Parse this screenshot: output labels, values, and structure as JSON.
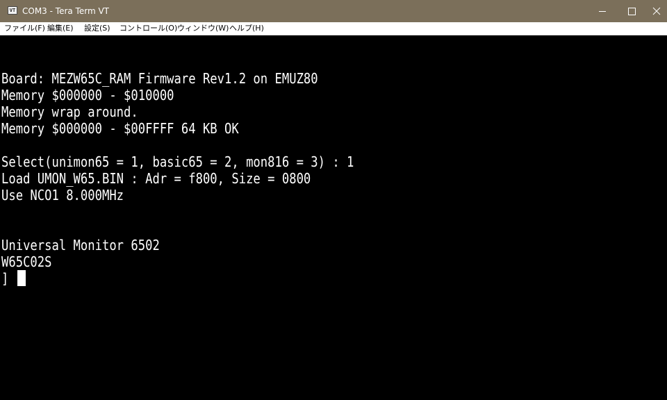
{
  "window": {
    "title": "COM3 - Tera Term VT",
    "icon_label": "VT",
    "titlebar_color": "#7b6f5a"
  },
  "menu": {
    "items": [
      {
        "label": "ファイル(F)"
      },
      {
        "label": "編集(E)"
      },
      {
        "label": "設定(S)"
      },
      {
        "label": "コントロール(O)"
      },
      {
        "label": "ウィンドウ(W)"
      },
      {
        "label": "ヘルプ(H)"
      }
    ]
  },
  "terminal": {
    "background": "#000000",
    "foreground": "#ffffff",
    "lines": [
      "Board: MEZW65C_RAM Firmware Rev1.2 on EMUZ80",
      "Memory $000000 - $010000",
      "Memory wrap around.",
      "Memory $000000 - $00FFFF 64 KB OK",
      "Select(unimon65 = 1, basic65 = 2, mon816 = 3) : 1",
      "Load UMON_W65.BIN : Adr = f800, Size = 0800",
      "Use NCO1 8.000MHz",
      "Universal Monitor 6502",
      "W65C02S",
      "]"
    ]
  }
}
